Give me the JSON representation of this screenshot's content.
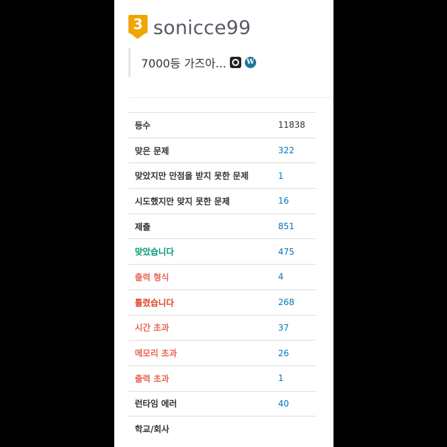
{
  "profile": {
    "tier": "3",
    "username": "sonicce99",
    "status_message": "7000등 가즈아...",
    "tier_color": "#f0a500"
  },
  "stats": [
    {
      "label": "등수",
      "value": "11838",
      "kind": "plain"
    },
    {
      "label": "맞은 문제",
      "value": "322",
      "kind": "default"
    },
    {
      "label": "맞았지만 만점을 받지 못한 문제",
      "value": "1",
      "kind": "default"
    },
    {
      "label": "시도했지만 맞지 못한 문제",
      "value": "16",
      "kind": "default"
    },
    {
      "label": "제출",
      "value": "851",
      "kind": "default"
    },
    {
      "label": "맞았습니다",
      "value": "475",
      "kind": "ok"
    },
    {
      "label": "출력 형식",
      "value": "4",
      "kind": "warn"
    },
    {
      "label": "틀렸습니다",
      "value": "268",
      "kind": "err"
    },
    {
      "label": "시간 초과",
      "value": "37",
      "kind": "warn"
    },
    {
      "label": "메모리 초과",
      "value": "26",
      "kind": "warn"
    },
    {
      "label": "출력 초과",
      "value": "1",
      "kind": "warn"
    },
    {
      "label": "런타임 에러",
      "value": "40",
      "kind": "default"
    },
    {
      "label": "학교/회사",
      "value": "",
      "kind": "default"
    }
  ],
  "icons": {
    "github": "github-icon",
    "wordpress": "wordpress-icon"
  },
  "colors": {
    "link": "#0076c0",
    "accepted": "#009874",
    "wrong": "#dd4124",
    "warning": "#e74c3c"
  }
}
